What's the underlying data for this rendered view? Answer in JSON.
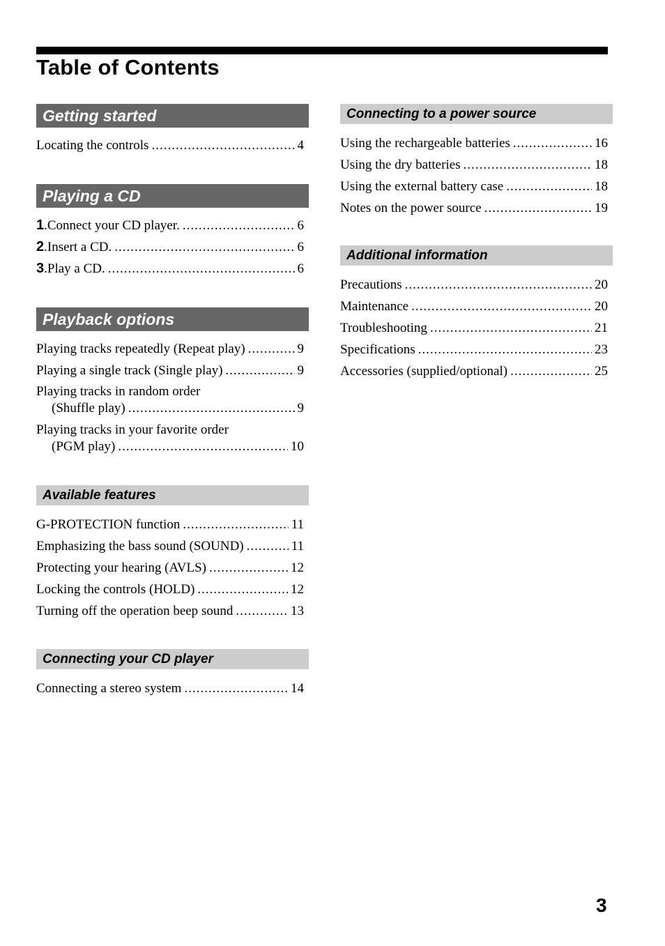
{
  "title": "Table of Contents",
  "page_number": "3",
  "left_column": [
    {
      "heading": "Getting started",
      "style": "dark",
      "entries": [
        {
          "label": "Locating the controls",
          "page": "4"
        }
      ]
    },
    {
      "heading": "Playing a CD",
      "style": "dark",
      "entries": [
        {
          "number": "1",
          "label": "Connect your CD player.",
          "page": "6"
        },
        {
          "number": "2",
          "label": "Insert a CD.",
          "page": "6"
        },
        {
          "number": "3",
          "label": "Play a CD.",
          "page": "6"
        }
      ]
    },
    {
      "heading": "Playback options",
      "style": "dark",
      "entries": [
        {
          "label": "Playing tracks repeatedly (Repeat play)",
          "page": "9"
        },
        {
          "label": "Playing a single track (Single play)",
          "page": "9"
        },
        {
          "label": "Playing tracks in random order",
          "label2": "(Shuffle play)",
          "page": "9"
        },
        {
          "label": "Playing tracks in your favorite order",
          "label2": "(PGM play)",
          "page": "10"
        }
      ]
    },
    {
      "heading": "Available features",
      "style": "light",
      "entries": [
        {
          "label": "G-PROTECTION function",
          "page": "11"
        },
        {
          "label": "Emphasizing the bass sound (SOUND)",
          "page": "11"
        },
        {
          "label": "Protecting your hearing (AVLS)",
          "page": "12"
        },
        {
          "label": "Locking the controls (HOLD)",
          "page": "12"
        },
        {
          "label": "Turning off the operation beep sound",
          "page": "13"
        }
      ]
    },
    {
      "heading": "Connecting your CD player",
      "style": "light",
      "entries": [
        {
          "label": "Connecting a stereo system",
          "page": "14"
        }
      ]
    }
  ],
  "right_column": [
    {
      "heading": "Connecting to a power source",
      "style": "light",
      "entries": [
        {
          "label": "Using the rechargeable batteries",
          "page": "16"
        },
        {
          "label": "Using the dry batteries",
          "page": "18"
        },
        {
          "label": "Using the external battery case",
          "page": "18"
        },
        {
          "label": "Notes on the power source",
          "page": "19"
        }
      ]
    },
    {
      "heading": "Additional information",
      "style": "light",
      "entries": [
        {
          "label": "Precautions",
          "page": "20"
        },
        {
          "label": "Maintenance",
          "page": "20"
        },
        {
          "label": "Troubleshooting",
          "page": "21"
        },
        {
          "label": "Specifications",
          "page": "23"
        },
        {
          "label": "Accessories (supplied/optional)",
          "page": "25"
        }
      ]
    }
  ],
  "colors": {
    "heading_dark_bg": "#666666",
    "heading_light_bg": "#cccccc",
    "text": "#000000"
  }
}
